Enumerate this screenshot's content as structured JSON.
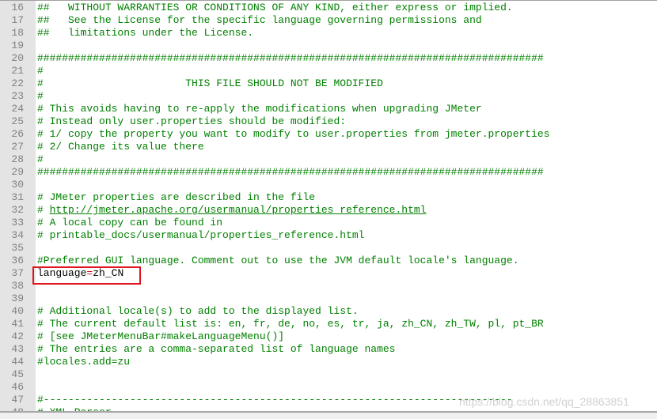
{
  "editor": {
    "lines": [
      {
        "n": "16",
        "text": "##   WITHOUT WARRANTIES OR CONDITIONS OF ANY KIND, either express or implied."
      },
      {
        "n": "17",
        "text": "##   See the License for the specific language governing permissions and"
      },
      {
        "n": "18",
        "text": "##   limitations under the License."
      },
      {
        "n": "19",
        "text": ""
      },
      {
        "n": "20",
        "text": "##################################################################################"
      },
      {
        "n": "21",
        "text": "#"
      },
      {
        "n": "22",
        "text": "#                       THIS FILE SHOULD NOT BE MODIFIED"
      },
      {
        "n": "23",
        "text": "#"
      },
      {
        "n": "24",
        "text": "# This avoids having to re-apply the modifications when upgrading JMeter"
      },
      {
        "n": "25",
        "text": "# Instead only user.properties should be modified:"
      },
      {
        "n": "26",
        "text": "# 1/ copy the property you want to modify to user.properties from jmeter.properties"
      },
      {
        "n": "27",
        "text": "# 2/ Change its value there"
      },
      {
        "n": "28",
        "text": "#"
      },
      {
        "n": "29",
        "text": "##################################################################################"
      },
      {
        "n": "30",
        "text": ""
      },
      {
        "n": "31",
        "text": "# JMeter properties are described in the file"
      },
      {
        "n": "32",
        "prefix": "# ",
        "url": "http://jmeter.apache.org/usermanual/properties_reference.html"
      },
      {
        "n": "33",
        "text": "# A local copy can be found in"
      },
      {
        "n": "34",
        "text": "# printable_docs/usermanual/properties_reference.html"
      },
      {
        "n": "35",
        "text": ""
      },
      {
        "n": "36",
        "text": "#Preferred GUI language. Comment out to use the JVM default locale's language."
      },
      {
        "n": "37",
        "key": "language",
        "op": "=",
        "value": "zh_CN"
      },
      {
        "n": "38",
        "text": ""
      },
      {
        "n": "39",
        "text": ""
      },
      {
        "n": "40",
        "text": "# Additional locale(s) to add to the displayed list."
      },
      {
        "n": "41",
        "text": "# The current default list is: en, fr, de, no, es, tr, ja, zh_CN, zh_TW, pl, pt_BR"
      },
      {
        "n": "42",
        "text": "# [see JMeterMenuBar#makeLanguageMenu()]"
      },
      {
        "n": "43",
        "text": "# The entries are a comma-separated list of language names"
      },
      {
        "n": "44",
        "text": "#locales.add=zu"
      },
      {
        "n": "45",
        "text": ""
      },
      {
        "n": "46",
        "text": ""
      },
      {
        "n": "47",
        "text": "#----------------------------------------------------------------------------"
      },
      {
        "n": "48",
        "text": "# XML Parser"
      }
    ],
    "highlighted_line": "37"
  },
  "colors": {
    "comment": "#008000",
    "key": "#000000",
    "operator": "#e00000",
    "gutter": "#e4e4e4",
    "highlight_box": "#e0141e"
  },
  "watermark": "https://blog.csdn.net/qq_28863851"
}
